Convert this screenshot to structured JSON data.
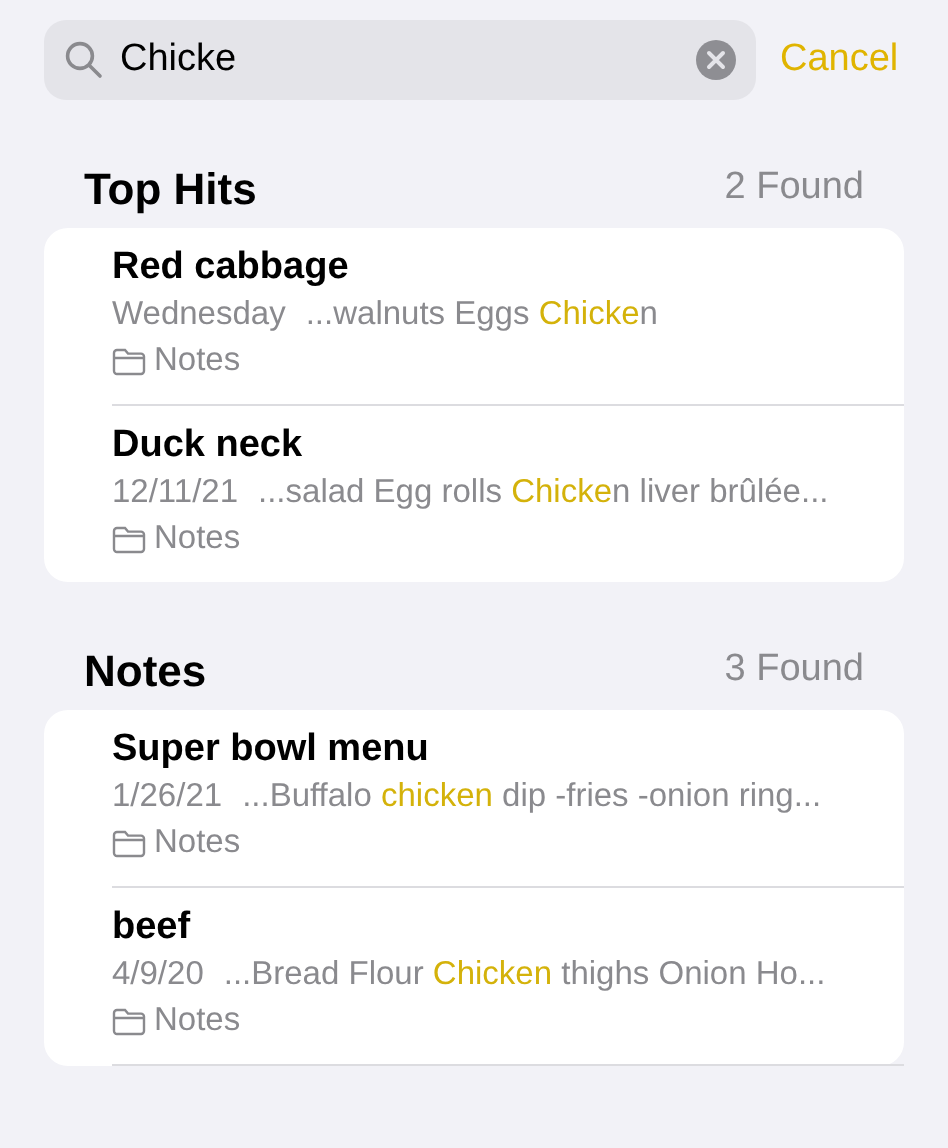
{
  "search": {
    "value": "Chicke",
    "cancel": "Cancel"
  },
  "sections": [
    {
      "title": "Top Hits",
      "count": "2 Found",
      "notes": [
        {
          "title": "Red cabbage",
          "date": "Wednesday",
          "snippet": [
            {
              "text": "...walnuts Eggs ",
              "highlighted": false
            },
            {
              "text": "Chicke",
              "highlighted": true
            },
            {
              "text": "n",
              "highlighted": false
            }
          ],
          "folder": "Notes"
        },
        {
          "title": "Duck neck",
          "date": "12/11/21",
          "snippet": [
            {
              "text": "...salad Egg rolls ",
              "highlighted": false
            },
            {
              "text": "Chicke",
              "highlighted": true
            },
            {
              "text": "n liver brûlée...",
              "highlighted": false
            }
          ],
          "folder": "Notes"
        }
      ]
    },
    {
      "title": "Notes",
      "count": "3 Found",
      "notes": [
        {
          "title": "Super bowl menu",
          "date": "1/26/21",
          "snippet": [
            {
              "text": "...Buffalo ",
              "highlighted": false
            },
            {
              "text": "chicken",
              "highlighted": true
            },
            {
              "text": " dip -fries -onion ring...",
              "highlighted": false
            }
          ],
          "folder": "Notes"
        },
        {
          "title": "beef",
          "date": "4/9/20",
          "snippet": [
            {
              "text": "...Bread Flour ",
              "highlighted": false
            },
            {
              "text": "Chicken",
              "highlighted": true
            },
            {
              "text": " thighs Onion Ho...",
              "highlighted": false
            }
          ],
          "folder": "Notes"
        }
      ]
    }
  ]
}
